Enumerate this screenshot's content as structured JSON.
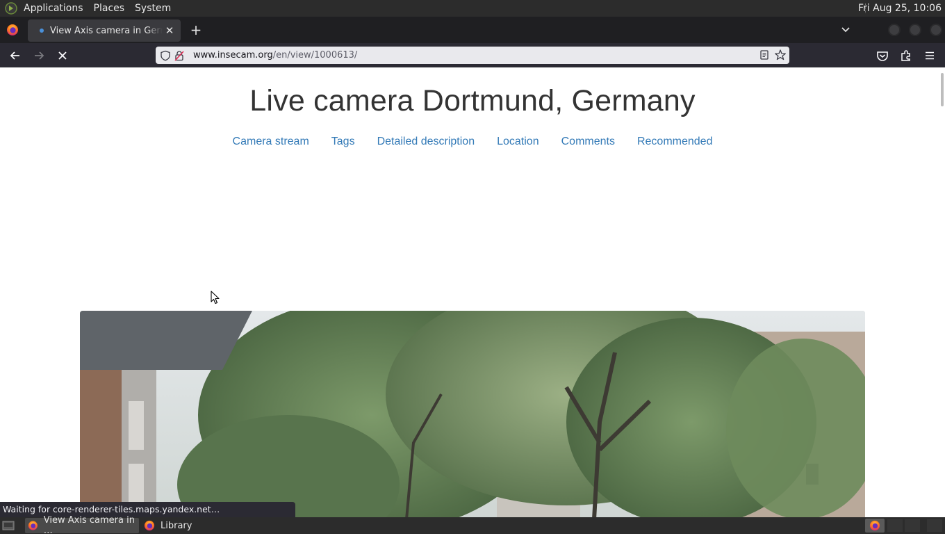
{
  "top_panel": {
    "menus": [
      "Applications",
      "Places",
      "System"
    ],
    "clock": "Fri Aug 25, 10:06"
  },
  "browser": {
    "tab": {
      "title": "View Axis camera in Germany"
    },
    "url": {
      "host": "www.insecam.org",
      "path": "/en/view/1000613/"
    }
  },
  "page": {
    "title": "Live camera Dortmund, Germany",
    "nav": [
      "Camera stream",
      "Tags",
      "Detailed description",
      "Location",
      "Comments",
      "Recommended"
    ]
  },
  "status_bar": {
    "text": "Waiting for core-renderer-tiles.maps.yandex.net…"
  },
  "taskbar": {
    "tasks": [
      {
        "label": "View Axis camera in …"
      },
      {
        "label": "Library"
      }
    ]
  },
  "colors": {
    "panel_bg": "#2c2c2c",
    "tabstrip_bg": "#1f1f22",
    "toolbar_bg": "#2b2a33",
    "link": "#337ab7",
    "title_text": "#333333"
  },
  "icons": {
    "panel_logo": "gnome-foot-icon",
    "firefox": "firefox-icon",
    "tab_close": "close-icon",
    "new_tab": "plus-icon",
    "tab_list": "chevron-down-icon",
    "back": "arrow-left-icon",
    "forward": "arrow-right-icon",
    "stop": "stop-x-icon",
    "shield": "shield-icon",
    "lock": "lock-insecure-icon",
    "reader": "reader-view-icon",
    "bookmark": "star-icon",
    "pocket": "pocket-icon",
    "extensions": "puzzle-icon",
    "menu": "hamburger-icon"
  }
}
